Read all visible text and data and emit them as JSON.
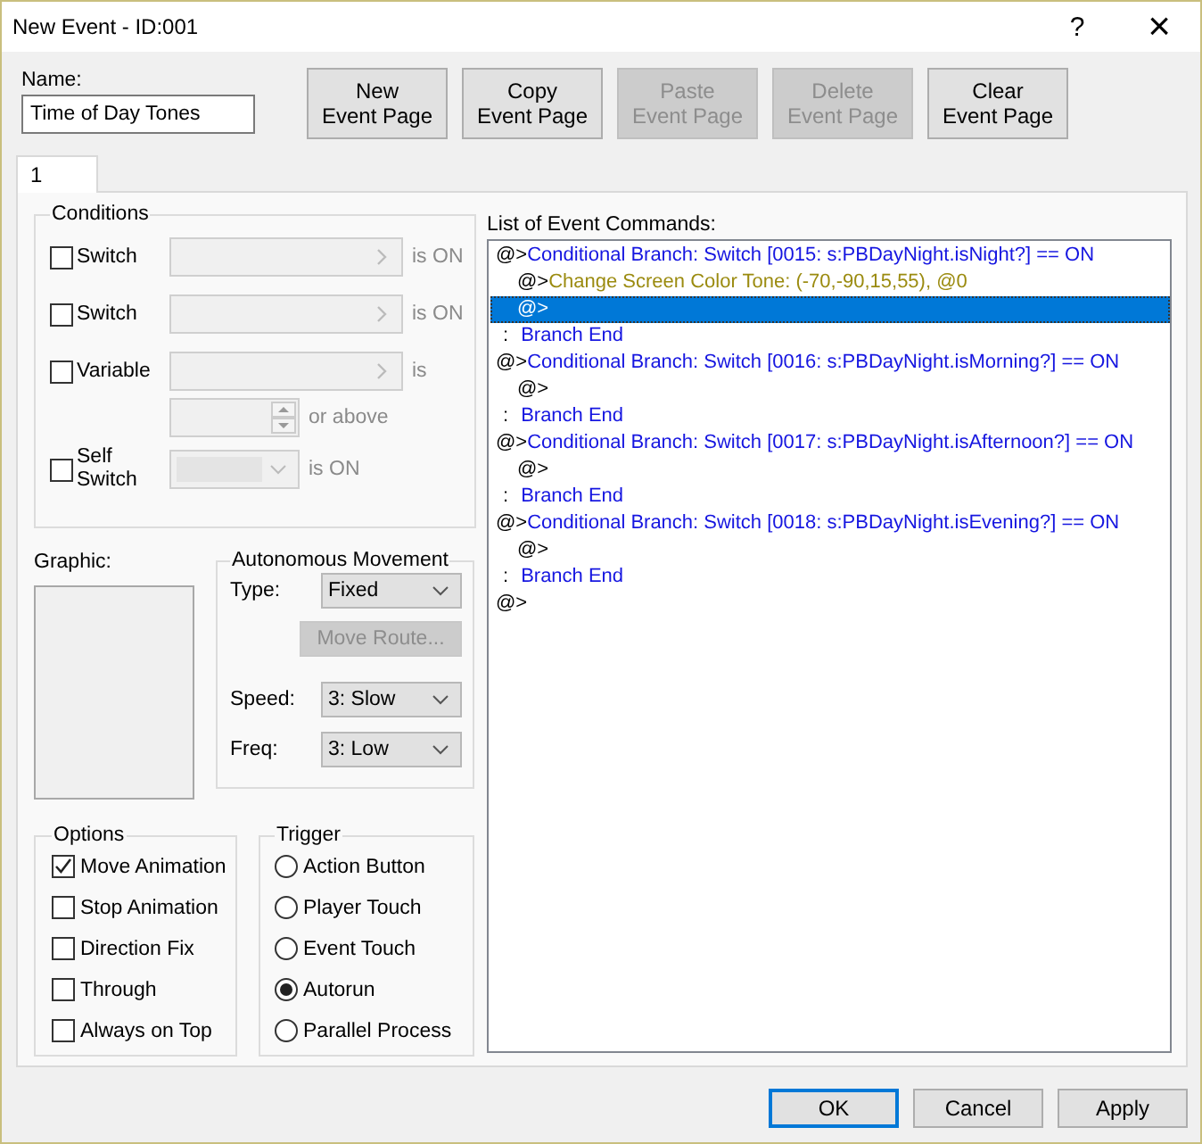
{
  "window": {
    "title": "New Event - ID:001",
    "help": "?",
    "close": "×"
  },
  "name_field": {
    "label": "Name:",
    "value": "Time of Day Tones"
  },
  "page_buttons": [
    {
      "label": "New\nEvent Page",
      "disabled": false
    },
    {
      "label": "Copy\nEvent Page",
      "disabled": false
    },
    {
      "label": "Paste\nEvent Page",
      "disabled": true
    },
    {
      "label": "Delete\nEvent Page",
      "disabled": true
    },
    {
      "label": "Clear\nEvent Page",
      "disabled": false
    }
  ],
  "tabs": [
    {
      "label": "1",
      "selected": true
    }
  ],
  "conditions": {
    "title": "Conditions",
    "rows": [
      {
        "kind": "switch",
        "label": "Switch",
        "checked": false,
        "suffix": "is ON"
      },
      {
        "kind": "switch",
        "label": "Switch",
        "checked": false,
        "suffix": "is ON"
      },
      {
        "kind": "variable",
        "label": "Variable",
        "checked": false,
        "suffix": "is",
        "spin_suffix": "or above"
      },
      {
        "kind": "self_switch",
        "label": "Self Switch",
        "checked": false,
        "suffix": "is ON"
      }
    ]
  },
  "graphic": {
    "label": "Graphic:"
  },
  "movement": {
    "title": "Autonomous Movement",
    "fields": [
      {
        "kind": "select",
        "label": "Type:",
        "value": "Fixed"
      },
      {
        "kind": "button",
        "label": "Move Route...",
        "disabled": true
      },
      {
        "kind": "select",
        "label": "Speed:",
        "value": "3: Slow"
      },
      {
        "kind": "select",
        "label": "Freq:",
        "value": "3: Low"
      }
    ]
  },
  "options": {
    "title": "Options",
    "items": [
      {
        "label": "Move Animation",
        "checked": true
      },
      {
        "label": "Stop Animation",
        "checked": false
      },
      {
        "label": "Direction Fix",
        "checked": false
      },
      {
        "label": "Through",
        "checked": false
      },
      {
        "label": "Always on Top",
        "checked": false
      }
    ]
  },
  "trigger": {
    "title": "Trigger",
    "items": [
      {
        "label": "Action Button",
        "selected": false
      },
      {
        "label": "Player Touch",
        "selected": false
      },
      {
        "label": "Event Touch",
        "selected": false
      },
      {
        "label": "Autorun",
        "selected": true
      },
      {
        "label": "Parallel Process",
        "selected": false
      }
    ]
  },
  "command_list": {
    "label": "List of Event Commands:",
    "commands": [
      {
        "kind": "branch",
        "marker": "@>",
        "text": "Conditional Branch: Switch [0015: s:PBDayNight.isNight?] == ON",
        "selected": false,
        "children": [
          {
            "kind": "tone",
            "marker": "@>",
            "text": "Change Screen Color Tone: (-70,-90,15,55), @0",
            "selected": false
          },
          {
            "kind": "empty",
            "marker": "@>",
            "selected": true
          }
        ]
      },
      {
        "kind": "end",
        "marker": ":",
        "text": "Branch End",
        "selected": false
      },
      {
        "kind": "branch",
        "marker": "@>",
        "text": "Conditional Branch: Switch [0016: s:PBDayNight.isMorning?] == ON",
        "selected": false,
        "children": [
          {
            "kind": "empty",
            "marker": "@>",
            "selected": false
          }
        ]
      },
      {
        "kind": "end",
        "marker": ":",
        "text": "Branch End",
        "selected": false
      },
      {
        "kind": "branch",
        "marker": "@>",
        "text": "Conditional Branch: Switch [0017: s:PBDayNight.isAfternoon?] == ON",
        "selected": false,
        "children": [
          {
            "kind": "empty",
            "marker": "@>",
            "selected": false
          }
        ]
      },
      {
        "kind": "end",
        "marker": ":",
        "text": "Branch End",
        "selected": false
      },
      {
        "kind": "branch",
        "marker": "@>",
        "text": "Conditional Branch: Switch [0018: s:PBDayNight.isEvening?] == ON",
        "selected": false,
        "children": [
          {
            "kind": "empty",
            "marker": "@>",
            "selected": false
          }
        ]
      },
      {
        "kind": "end",
        "marker": ":",
        "text": "Branch End",
        "selected": false
      },
      {
        "kind": "empty",
        "marker": "@>",
        "selected": false
      }
    ]
  },
  "dialog_buttons": [
    {
      "label": "OK",
      "default": true
    },
    {
      "label": "Cancel",
      "default": false
    },
    {
      "label": "Apply",
      "default": false
    }
  ]
}
